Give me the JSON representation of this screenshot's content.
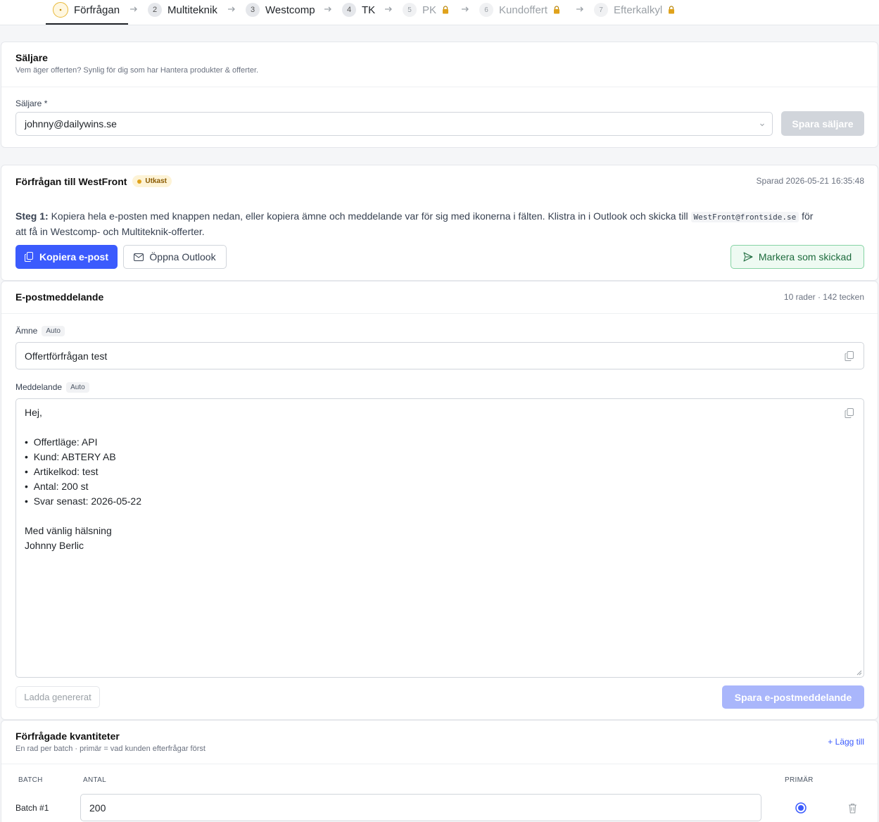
{
  "stepper": {
    "steps": [
      {
        "num": "",
        "label": "Förfrågan",
        "state": "active"
      },
      {
        "num": "2",
        "label": "Multiteknik",
        "state": "done"
      },
      {
        "num": "3",
        "label": "Westcomp",
        "state": "done"
      },
      {
        "num": "4",
        "label": "TK",
        "state": "done"
      },
      {
        "num": "5",
        "label": "PK",
        "state": "locked"
      },
      {
        "num": "6",
        "label": "Kundoffert",
        "state": "locked"
      },
      {
        "num": "7",
        "label": "Efterkalkyl",
        "state": "locked"
      }
    ]
  },
  "seller": {
    "title": "Säljare",
    "subtitle": "Vem äger offerten? Synlig för dig som har Hantera produkter & offerter.",
    "field_label": "Säljare *",
    "value": "johnny@dailywins.se",
    "save_label": "Spara säljare"
  },
  "request": {
    "title": "Förfrågan till WestFront",
    "status_badge": "Utkast",
    "saved_text": "Sparad 2026-05-21 16:35:48",
    "step_bold": "Steg 1:",
    "step_text_1": " Kopiera hela e-posten med knappen nedan, eller kopiera ämne och meddelande var för sig med ikonerna i fälten. Klistra in i Outlook och skicka till ",
    "step_email": "WestFront@frontside.se",
    "step_text_2": " för",
    "step_text_3": "att få in Westcomp- och Multiteknik-offerter.",
    "copy_email_label": "Kopiera e-post",
    "open_outlook_label": "Öppna Outlook",
    "mark_sent_label": "Markera som skickad"
  },
  "email": {
    "title": "E-postmeddelande",
    "meta": "10 rader · 142 tecken",
    "subject_label": "Ämne",
    "auto_badge": "Auto",
    "subject_value": "Offertförfrågan test",
    "message_label": "Meddelande",
    "message_greeting": "Hej,",
    "message_bullets": [
      "Offertläge: API",
      "Kund: ABTERY AB",
      "Artikelkod: test",
      "Antal: 200 st",
      "Svar senast: 2026-05-22"
    ],
    "message_closing": "Med vänlig hälsning",
    "message_signature": "Johnny Berlic",
    "load_generated_label": "Ladda genererat",
    "save_label": "Spara e-postmeddelande"
  },
  "quantities": {
    "title": "Förfrågade kvantiteter",
    "subtitle": "En rad per batch · primär = vad kunden efterfrågar först",
    "add_label": "+ Lägg till",
    "columns": {
      "batch": "BATCH",
      "antal": "ANTAL",
      "primary": "PRIMÄR"
    },
    "rows": [
      {
        "batch": "Batch #1",
        "antal": "200",
        "primary": true
      }
    ]
  },
  "colors": {
    "primary": "#3b5bfd",
    "success_border": "#86d3a4",
    "success_bg": "#eefaf2",
    "badge_bg": "#fdf3d6"
  }
}
